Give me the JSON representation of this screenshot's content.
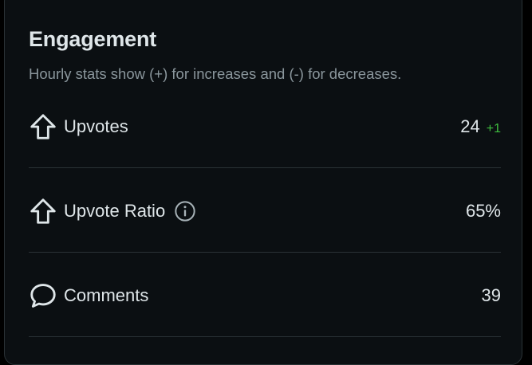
{
  "engagement": {
    "title": "Engagement",
    "subtitle": "Hourly stats show (+) for increases and (-) for decreases.",
    "rows": [
      {
        "icon": "upvote-icon",
        "label": "Upvotes",
        "value": "24",
        "delta": "+1"
      },
      {
        "icon": "upvote-icon",
        "label": "Upvote Ratio",
        "value": "65%",
        "info_icon": "info-icon"
      },
      {
        "icon": "comment-icon",
        "label": "Comments",
        "value": "39"
      }
    ]
  },
  "colors": {
    "background": "#0b0f12",
    "text": "#dfe6e9",
    "muted": "#8a969c",
    "positive": "#3fbf3f",
    "divider": "#2a3236"
  }
}
